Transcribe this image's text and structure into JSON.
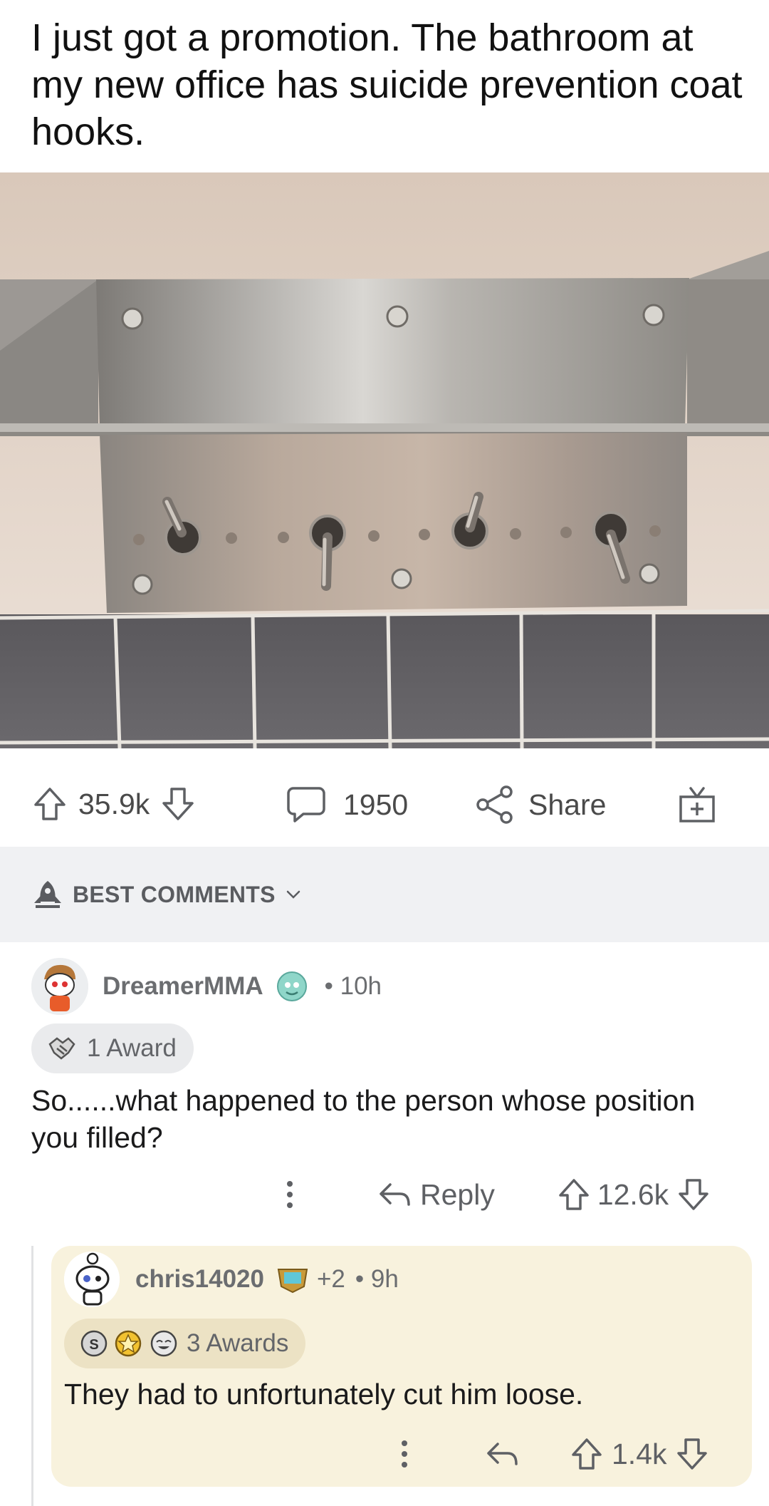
{
  "post": {
    "title": "I just got a promotion. The bathroom at my new office has suicide prevention coat hooks.",
    "image_alt": "stainless steel coat hook panel with hinged hooks above grey tiles"
  },
  "actions": {
    "upvotes": "35.9k",
    "comments": "1950",
    "share_label": "Share"
  },
  "sort": {
    "label": "BEST COMMENTS"
  },
  "comments": [
    {
      "username": "DreamerMMA",
      "time": "• 10h",
      "awards": "1 Award",
      "body": "So......what happened to the person whose position you filled?",
      "reply_label": "Reply",
      "score": "12.6k"
    },
    {
      "username": "chris14020",
      "extra": "+2",
      "time": "• 9h",
      "awards": "3 Awards",
      "body": "They had to unfortunately cut him loose.",
      "score": "1.4k"
    }
  ],
  "colors": {
    "icon_grey": "#5e6064",
    "sort_band": "#f0f1f3",
    "reply_bg": "#f8f2dd"
  }
}
